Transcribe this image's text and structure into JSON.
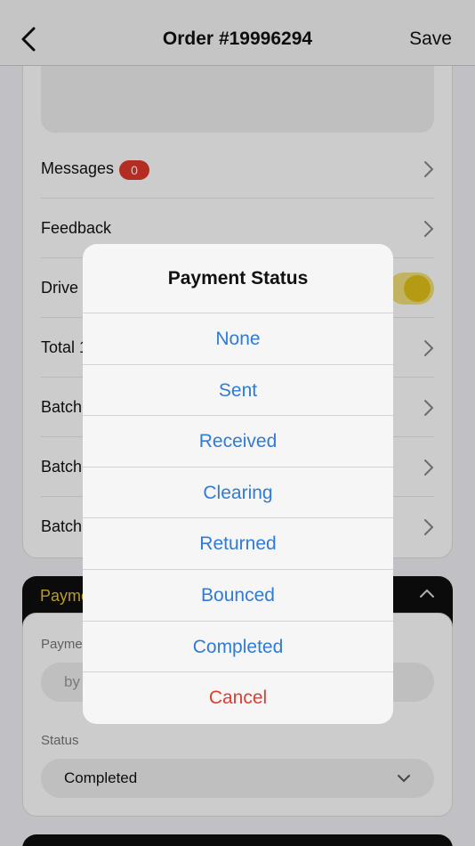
{
  "header": {
    "title": "Order #19996294",
    "save_label": "Save"
  },
  "card": {
    "rows": [
      {
        "label": "Messages",
        "badge": "0"
      },
      {
        "label": "Feedback"
      },
      {
        "label": "Drive t"
      },
      {
        "label": "Total 1"
      },
      {
        "label": "Batch"
      },
      {
        "label": "Batch"
      },
      {
        "label": "Batch"
      }
    ],
    "toggle_on": true
  },
  "payment": {
    "section_label": "Payme",
    "field1_label": "Payme",
    "field1_placeholder": "by",
    "status_label": "Status",
    "status_value": "Completed"
  },
  "sheet": {
    "title": "Payment Status",
    "options": [
      "None",
      "Sent",
      "Received",
      "Clearing",
      "Returned",
      "Bounced",
      "Completed"
    ],
    "cancel": "Cancel"
  },
  "colors": {
    "accent_blue": "#2f7bd5",
    "cancel_red": "#e23c30",
    "badge_red": "#e0392b",
    "gold": "#e8c131"
  }
}
